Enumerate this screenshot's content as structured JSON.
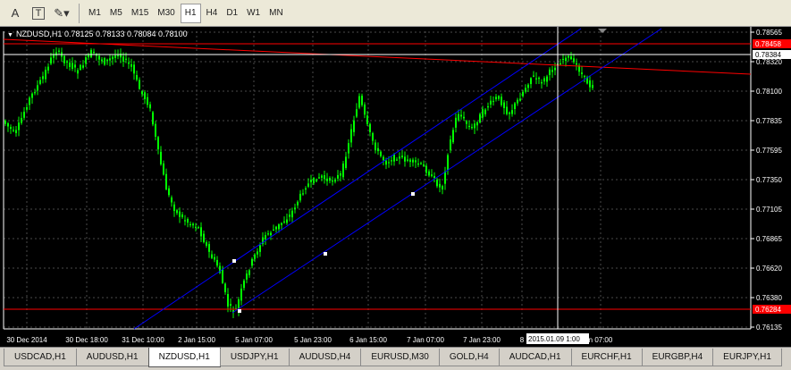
{
  "toolbar": {
    "tools": [
      {
        "name": "text-a-icon",
        "glyph": "A"
      },
      {
        "name": "text-label-icon",
        "glyph": "T"
      },
      {
        "name": "arrows-shapes-icon",
        "glyph": "✎▾"
      }
    ],
    "timeframes": [
      "M1",
      "M5",
      "M15",
      "M30",
      "H1",
      "H4",
      "D1",
      "W1",
      "MN"
    ],
    "active_timeframe": "H1"
  },
  "chart": {
    "symbol_line": "NZDUSD,H1  0.78125 0.78133 0.78084 0.78100",
    "price_labels": [
      "0.78565",
      "0.78320",
      "0.78100",
      "0.77835",
      "0.77595",
      "0.77350",
      "0.77105",
      "0.76865",
      "0.76620",
      "0.76380",
      "0.76135"
    ],
    "marker_labels": [
      {
        "text": "0.78458",
        "bg": "#ff0000",
        "fg": "#ffffff"
      },
      {
        "text": "0.78384",
        "bg": "#ffffff",
        "fg": "#000000"
      },
      {
        "text": "0.76284",
        "bg": "#ff0000",
        "fg": "#ffffff"
      }
    ],
    "time_labels": [
      "30 Dec 2014",
      "30 Dec 18:00",
      "31 Dec 10:00",
      "2 Jan 15:00",
      "5 Jan 07:00",
      "5 Jan 23:00",
      "6 Jan 15:00",
      "7 Jan 07:00",
      "7 Jan 23:00",
      "8",
      "n 07:00"
    ],
    "crosshair_time_label": "2015.01.09 1:00",
    "colors": {
      "background": "#000000",
      "bull": "#00ff00",
      "grid": "#4a4a4a",
      "channel": "#0000ff",
      "hline": "#ff0000"
    }
  },
  "tabs": [
    "USDCAD,H1",
    "AUDUSD,H1",
    "NZDUSD,H1",
    "USDJPY,H1",
    "AUDUSD,H4",
    "EURUSD,M30",
    "GOLD,H4",
    "AUDCAD,H1",
    "EURCHF,H1",
    "EURGBP,H4",
    "EURJPY,H1"
  ],
  "active_tab": "NZDUSD,H1"
}
